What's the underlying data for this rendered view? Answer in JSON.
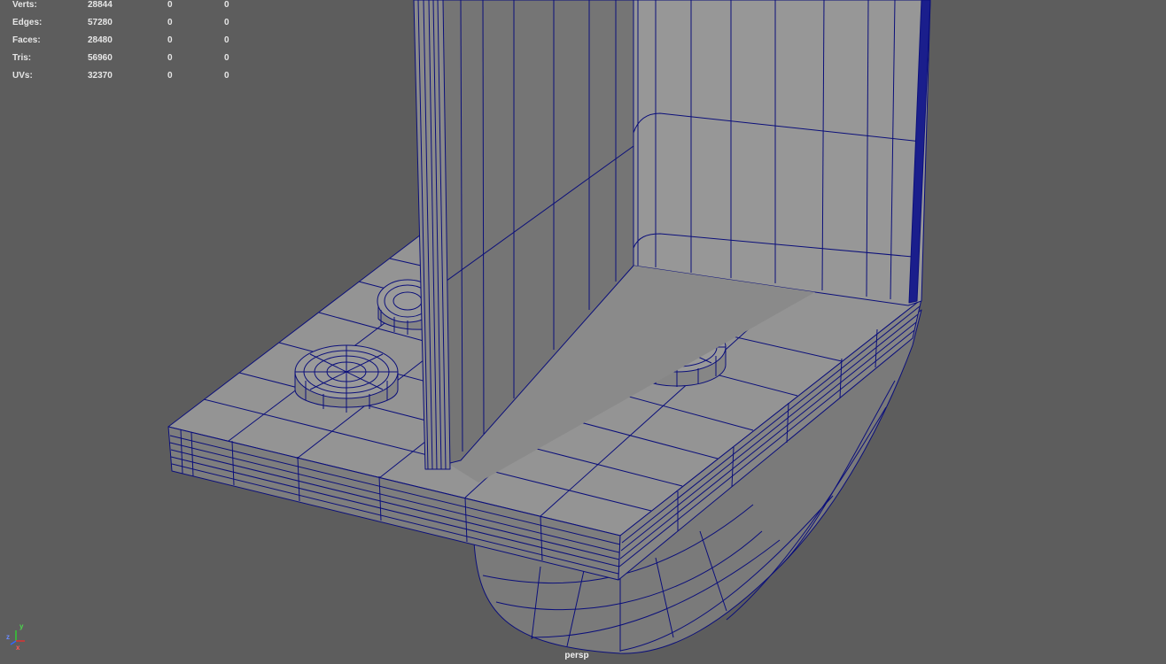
{
  "hud": {
    "rows": [
      {
        "label": "Verts:",
        "total": "28844",
        "selected": "0",
        "extra": "0"
      },
      {
        "label": "Edges:",
        "total": "57280",
        "selected": "0",
        "extra": "0"
      },
      {
        "label": "Faces:",
        "total": "28480",
        "selected": "0",
        "extra": "0"
      },
      {
        "label": "Tris:",
        "total": "56960",
        "selected": "0",
        "extra": "0"
      },
      {
        "label": "UVs:",
        "total": "32370",
        "selected": "0",
        "extra": "0"
      }
    ]
  },
  "camera": {
    "name": "persp"
  },
  "axis_gizmo": {
    "x": "x",
    "y": "y",
    "z": "z"
  },
  "colors": {
    "background": "#5d5d5d",
    "mesh_fill": "#8c8c8c",
    "mesh_shadow": "#6f6f6f",
    "wire": "#0b0f7a",
    "hud_text": "#e6e6e6"
  }
}
